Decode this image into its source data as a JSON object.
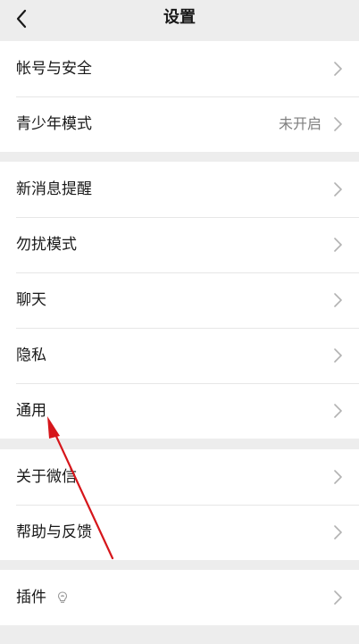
{
  "header": {
    "title": "设置",
    "back_icon": "chevron-left-icon"
  },
  "groups": [
    {
      "items": [
        {
          "label": "帐号与安全",
          "value": ""
        },
        {
          "label": "青少年模式",
          "value": "未开启"
        }
      ]
    },
    {
      "items": [
        {
          "label": "新消息提醒",
          "value": ""
        },
        {
          "label": "勿扰模式",
          "value": ""
        },
        {
          "label": "聊天",
          "value": ""
        },
        {
          "label": "隐私",
          "value": ""
        },
        {
          "label": "通用",
          "value": ""
        }
      ]
    },
    {
      "items": [
        {
          "label": "关于微信",
          "value": ""
        },
        {
          "label": "帮助与反馈",
          "value": ""
        }
      ]
    },
    {
      "items": [
        {
          "label": "插件",
          "value": "",
          "icon": "lightbulb-icon"
        }
      ]
    }
  ],
  "colors": {
    "background": "#ededed",
    "surface": "#ffffff",
    "annotation_arrow": "#d6161b"
  }
}
